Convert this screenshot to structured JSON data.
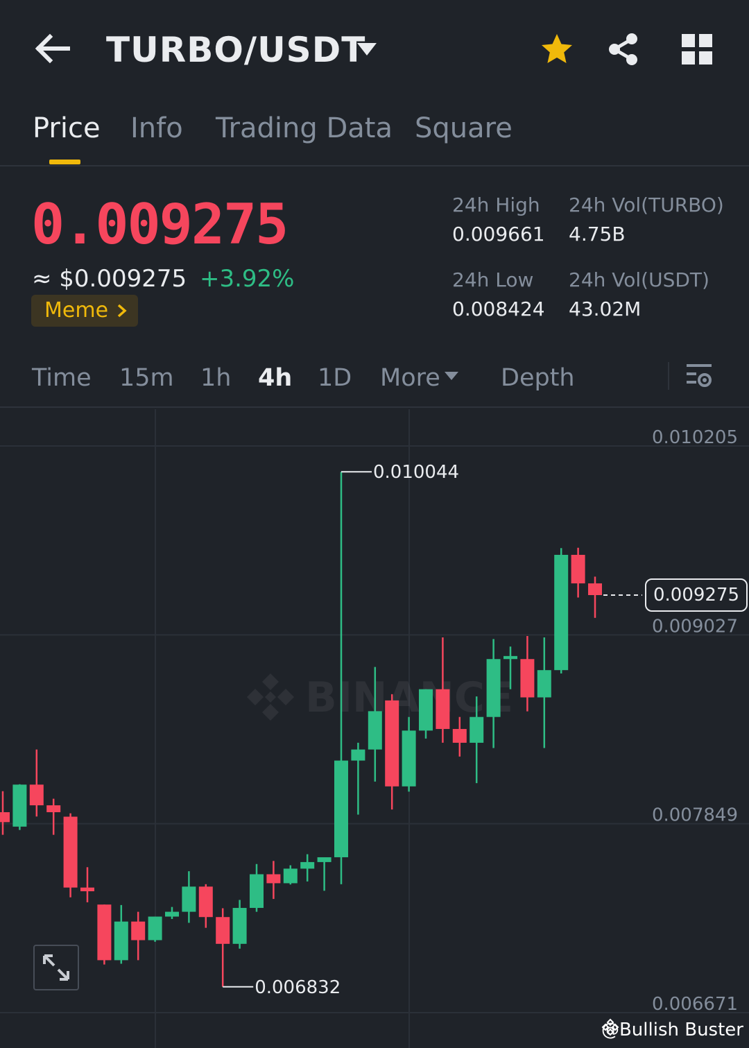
{
  "header": {
    "pair": "TURBO/USDT",
    "icons": [
      "back-arrow-icon",
      "caret-down-icon",
      "star-icon",
      "share-icon",
      "grid-icon"
    ],
    "star_color": "#f0b90b"
  },
  "tabs": [
    {
      "label": "Price",
      "active": true
    },
    {
      "label": "Info",
      "active": false
    },
    {
      "label": "Trading Data",
      "active": false
    },
    {
      "label": "Square",
      "active": false
    }
  ],
  "ticker": {
    "last_price": "0.009275",
    "usd_price": "≈ $0.009275",
    "change": "+3.92%",
    "tag": "Meme",
    "high_label": "24h High",
    "high_value": "0.009661",
    "vol_base_label": "24h Vol(TURBO)",
    "vol_base_value": "4.75B",
    "low_label": "24h Low",
    "low_value": "0.008424",
    "vol_quote_label": "24h Vol(USDT)",
    "vol_quote_value": "43.02M",
    "colors": {
      "down": "#f6465d",
      "up": "#2ebd85",
      "accent": "#f0b90b"
    }
  },
  "intervals": [
    {
      "label": "Time",
      "active": false
    },
    {
      "label": "15m",
      "active": false
    },
    {
      "label": "1h",
      "active": false
    },
    {
      "label": "4h",
      "active": true
    },
    {
      "label": "1D",
      "active": false
    },
    {
      "label": "More",
      "active": false
    },
    {
      "label": "Depth",
      "active": false
    }
  ],
  "chart_data": {
    "type": "candlestick",
    "interval": "4h",
    "ylim": [
      0.006671,
      0.010205
    ],
    "y_ticks": [
      "0.010205",
      "0.009027",
      "0.007849",
      "0.006671"
    ],
    "last_price_label": "0.009275",
    "max_label": "0.010044",
    "min_label": "0.006832",
    "watermark": "BINANCE",
    "credit": "@Bullish Buster",
    "candles": [
      {
        "o": 0.007921,
        "h": 0.008052,
        "l": 0.00778,
        "c": 0.007859
      },
      {
        "o": 0.007831,
        "h": 0.008095,
        "l": 0.00781,
        "c": 0.008093
      },
      {
        "o": 0.008093,
        "h": 0.008312,
        "l": 0.007894,
        "c": 0.007964
      },
      {
        "o": 0.007964,
        "h": 0.008005,
        "l": 0.00778,
        "c": 0.007921
      },
      {
        "o": 0.007893,
        "h": 0.007914,
        "l": 0.00739,
        "c": 0.007451
      },
      {
        "o": 0.007451,
        "h": 0.007578,
        "l": 0.007359,
        "c": 0.007428
      },
      {
        "o": 0.007345,
        "h": 0.007345,
        "l": 0.006971,
        "c": 0.006998
      },
      {
        "o": 0.006998,
        "h": 0.007342,
        "l": 0.006976,
        "c": 0.007239
      },
      {
        "o": 0.007239,
        "h": 0.0073,
        "l": 0.006998,
        "c": 0.007123
      },
      {
        "o": 0.007123,
        "h": 0.00727,
        "l": 0.007113,
        "c": 0.00727
      },
      {
        "o": 0.00727,
        "h": 0.00733,
        "l": 0.007255,
        "c": 0.0073
      },
      {
        "o": 0.0073,
        "h": 0.007553,
        "l": 0.007231,
        "c": 0.007457
      },
      {
        "o": 0.007457,
        "h": 0.007472,
        "l": 0.0072,
        "c": 0.007267
      },
      {
        "o": 0.007267,
        "h": 0.007322,
        "l": 0.006832,
        "c": 0.0071
      },
      {
        "o": 0.0071,
        "h": 0.007374,
        "l": 0.00707,
        "c": 0.007324
      },
      {
        "o": 0.007324,
        "h": 0.007598,
        "l": 0.0073,
        "c": 0.007534
      },
      {
        "o": 0.007534,
        "h": 0.007617,
        "l": 0.00738,
        "c": 0.007478
      },
      {
        "o": 0.007478,
        "h": 0.00759,
        "l": 0.00747,
        "c": 0.007569
      },
      {
        "o": 0.007569,
        "h": 0.007659,
        "l": 0.007489,
        "c": 0.00761
      },
      {
        "o": 0.00761,
        "h": 0.007625,
        "l": 0.007431,
        "c": 0.00764
      },
      {
        "o": 0.00764,
        "h": 0.010044,
        "l": 0.007472,
        "c": 0.008243
      },
      {
        "o": 0.008243,
        "h": 0.008354,
        "l": 0.007906,
        "c": 0.008312
      },
      {
        "o": 0.008312,
        "h": 0.008827,
        "l": 0.008112,
        "c": 0.008551
      },
      {
        "o": 0.008618,
        "h": 0.008657,
        "l": 0.007938,
        "c": 0.008082
      },
      {
        "o": 0.008082,
        "h": 0.008515,
        "l": 0.008049,
        "c": 0.00843
      },
      {
        "o": 0.00843,
        "h": 0.008688,
        "l": 0.00838,
        "c": 0.008688
      },
      {
        "o": 0.008688,
        "h": 0.009011,
        "l": 0.008354,
        "c": 0.00844
      },
      {
        "o": 0.00844,
        "h": 0.008515,
        "l": 0.008268,
        "c": 0.008354
      },
      {
        "o": 0.008354,
        "h": 0.008643,
        "l": 0.008102,
        "c": 0.008515
      },
      {
        "o": 0.008515,
        "h": 0.009001,
        "l": 0.008321,
        "c": 0.008876
      },
      {
        "o": 0.008876,
        "h": 0.008954,
        "l": 0.008688,
        "c": 0.008895
      },
      {
        "o": 0.008876,
        "h": 0.00902,
        "l": 0.00855,
        "c": 0.008637
      },
      {
        "o": 0.008637,
        "h": 0.009011,
        "l": 0.008321,
        "c": 0.008807
      },
      {
        "o": 0.008807,
        "h": 0.009568,
        "l": 0.008786,
        "c": 0.009526
      },
      {
        "o": 0.009526,
        "h": 0.00957,
        "l": 0.00926,
        "c": 0.009348
      },
      {
        "o": 0.009348,
        "h": 0.00939,
        "l": 0.009133,
        "c": 0.009275
      }
    ]
  }
}
